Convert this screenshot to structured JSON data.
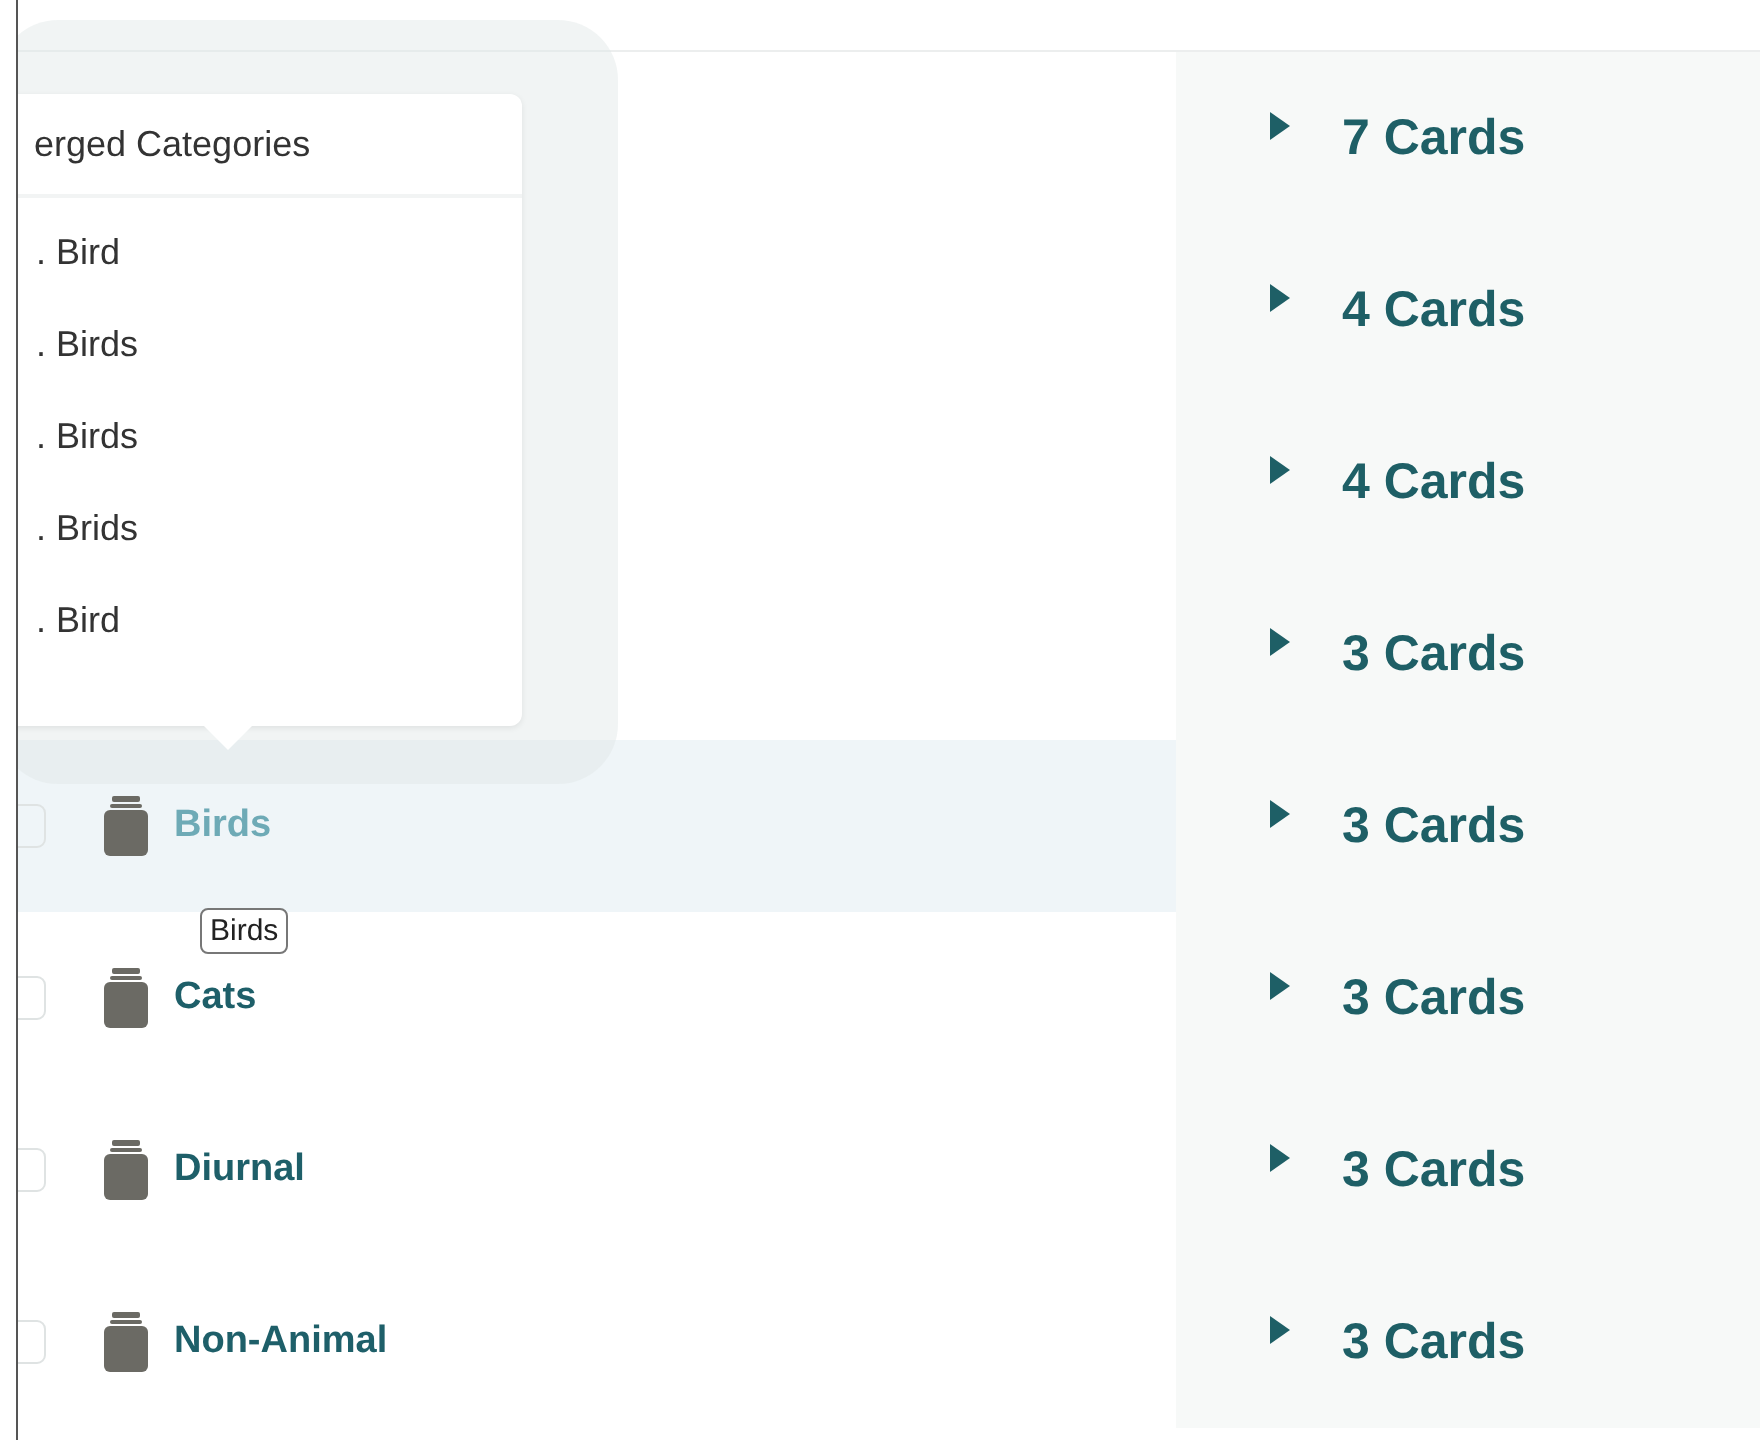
{
  "popup": {
    "title": "erged Categories",
    "items": [
      ". Bird",
      ". Birds",
      ". Birds",
      ". Brids",
      ". Bird"
    ]
  },
  "rows": [
    {
      "cards": "7 Cards"
    },
    {
      "cards": "4 Cards"
    },
    {
      "cards": "4 Cards"
    },
    {
      "cards": "3 Cards"
    },
    {
      "name": "Birds",
      "checked": false,
      "selected": true,
      "tooltip": "Birds",
      "cards": "3 Cards"
    },
    {
      "name": "Cats",
      "checked": false,
      "selected": false,
      "cards": "3 Cards"
    },
    {
      "name": "Diurnal",
      "checked": false,
      "selected": false,
      "cards": "3 Cards"
    },
    {
      "name": "Non-Animal",
      "checked": false,
      "selected": false,
      "cards": "3 Cards"
    }
  ]
}
